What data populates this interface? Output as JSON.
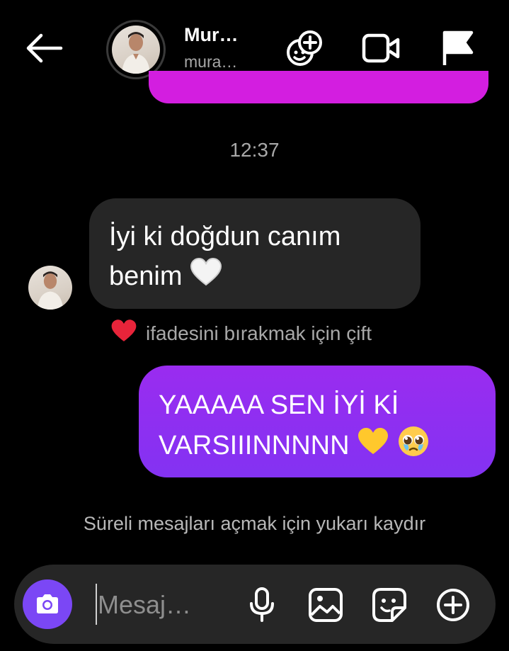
{
  "header": {
    "name": "Mur…",
    "username": "mura…",
    "icons": [
      "back-arrow-icon",
      "effects-icon",
      "video-call-icon",
      "flag-icon"
    ]
  },
  "thread": {
    "timestamp": "12:37",
    "incoming": {
      "text": "İyi ki doğdun canım benim",
      "emoji": "white-heart"
    },
    "react_hint": {
      "emoji": "red-heart",
      "text": "ifadesini bırakmak için çift"
    },
    "outgoing": {
      "line1": "YAAAAA SEN İYİ Kİ",
      "line2": "VARSIIINNNNN",
      "emojis": [
        "yellow-heart",
        "pleading-face"
      ]
    },
    "vanish_hint": "Süreli mesajları açmak için yukarı kaydır"
  },
  "composer": {
    "placeholder": "Mesaj…",
    "icons": [
      "camera-icon",
      "microphone-icon",
      "gallery-icon",
      "sticker-icon",
      "plus-icon"
    ]
  },
  "colors": {
    "background": "#000000",
    "incoming_bubble": "#262626",
    "outgoing_bubble": "#8a2ff1",
    "previous_bubble": "#d31ee0",
    "camera_button": "#7b47f5",
    "secondary_text": "#a8a8a8"
  }
}
